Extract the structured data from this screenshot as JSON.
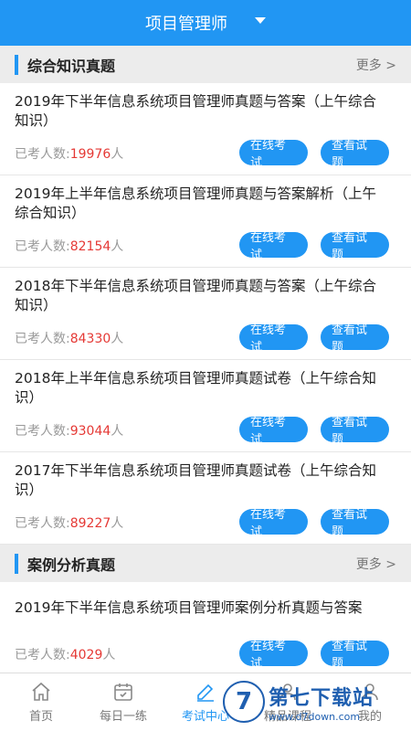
{
  "header": {
    "title": "项目管理师"
  },
  "sections": [
    {
      "title": "综合知识真题",
      "more": "更多 >",
      "items": [
        {
          "title": "2019年下半年信息系统项目管理师真题与答案（上午综合知识）",
          "meta_label": "已考人数:",
          "count": "19976",
          "unit": "人",
          "btn_online": "在线考试",
          "btn_view": "查看试题"
        },
        {
          "title": "2019年上半年信息系统项目管理师真题与答案解析（上午综合知识）",
          "meta_label": "已考人数:",
          "count": "82154",
          "unit": "人",
          "btn_online": "在线考试",
          "btn_view": "查看试题"
        },
        {
          "title": "2018年下半年信息系统项目管理师真题与答案（上午综合知识）",
          "meta_label": "已考人数:",
          "count": "84330",
          "unit": "人",
          "btn_online": "在线考试",
          "btn_view": "查看试题"
        },
        {
          "title": "2018年上半年信息系统项目管理师真题试卷（上午综合知识）",
          "meta_label": "已考人数:",
          "count": "93044",
          "unit": "人",
          "btn_online": "在线考试",
          "btn_view": "查看试题"
        },
        {
          "title": "2017年下半年信息系统项目管理师真题试卷（上午综合知识）",
          "meta_label": "已考人数:",
          "count": "89227",
          "unit": "人",
          "btn_online": "在线考试",
          "btn_view": "查看试题"
        }
      ]
    },
    {
      "title": "案例分析真题",
      "more": "更多 >",
      "items": [
        {
          "title": "2019年下半年信息系统项目管理师案例分析真题与答案",
          "meta_label": "已考人数:",
          "count": "4029",
          "unit": "人",
          "btn_online": "在线考试",
          "btn_view": "查看试题"
        }
      ]
    }
  ],
  "tabbar": [
    {
      "label": "首页",
      "icon": "home-icon"
    },
    {
      "label": "每日一练",
      "icon": "calendar-icon"
    },
    {
      "label": "考试中心",
      "icon": "pen-icon",
      "active": true
    },
    {
      "label": "精品课程",
      "icon": "course-icon"
    },
    {
      "label": "我的",
      "icon": "user-icon"
    }
  ],
  "watermark": {
    "logo": "7",
    "main": "第七下载站",
    "sub": "www.d7down.com"
  },
  "colors": {
    "primary": "#2196f3",
    "count": "#e53935"
  }
}
